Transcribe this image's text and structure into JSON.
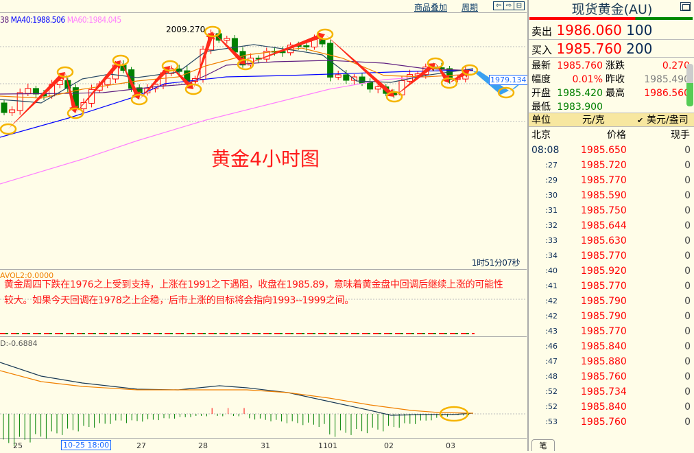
{
  "toolbar": {
    "overlay": "商品叠加",
    "period": "周期",
    "nav_left": "⇦",
    "nav_right": "⇨",
    "nav_split": "⊟"
  },
  "ma_legend": {
    "ma_prev": "38",
    "ma40": "MA40:1988.506",
    "ma60": "MA60:1984.045"
  },
  "chart": {
    "high_label": "2009.270",
    "title": "黄金4小时图",
    "projection_label": "1979.134",
    "countdown": "1时51分07秒",
    "colors": {
      "up": "#ff0000",
      "down": "#008000",
      "ma40": "#0000ff",
      "ma60": "#ff80ff",
      "arrow": "#ff2a1a",
      "circle": "#f5b400",
      "projection": "#3aa0f0"
    }
  },
  "volume": {
    "label": "AVOL2:0.0000"
  },
  "analysis": {
    "text": "黄金周四下跌在1976之上受到支持，上涨在1991之下遇阻，收盘在1985.89，意味着黄金盘中回调后继续上涨的可能性较大。如果今天回调在1978之上企稳，后市上涨的目标将会指向1993--1999之间。"
  },
  "macd": {
    "label": "D:-0.6884"
  },
  "xaxis": {
    "labels": [
      "25",
      "27",
      "28",
      "31",
      "1101",
      "02",
      "03"
    ],
    "cursor": "10-25 18:00"
  },
  "panel": {
    "title": "现货黄金(AU)",
    "sell": {
      "label": "卖出",
      "price": "1986.060",
      "vol": "100"
    },
    "buy": {
      "label": "买入",
      "price": "1985.760",
      "vol": "200"
    },
    "stats": [
      {
        "label": "最新",
        "value": "1985.760",
        "color": "#ff0000"
      },
      {
        "label": "涨跌",
        "value": "0.270",
        "color": "#ff0000"
      },
      {
        "label": "幅度",
        "value": "0.01%",
        "color": "#ff0000"
      },
      {
        "label": "昨收",
        "value": "1985.490",
        "color": "#808080"
      },
      {
        "label": "开盘",
        "value": "1985.420",
        "color": "#008000"
      },
      {
        "label": "最高",
        "value": "1986.560",
        "color": "#ff0000"
      },
      {
        "label": "最低",
        "value": "1983.900",
        "color": "#008000"
      }
    ],
    "unit": {
      "label": "单位",
      "opt1": "元/克",
      "opt2": "美元/盎司",
      "check": "✔"
    },
    "ticks_header": {
      "place": "北京",
      "price": "价格",
      "vol": "现手"
    },
    "ticks": [
      {
        "t": "08:08",
        "p": "1985.650",
        "v": "0"
      },
      {
        "t": ":27",
        "p": "1985.720",
        "v": "0"
      },
      {
        "t": ":29",
        "p": "1985.770",
        "v": "0"
      },
      {
        "t": ":30",
        "p": "1985.590",
        "v": "0"
      },
      {
        "t": ":31",
        "p": "1985.750",
        "v": "0"
      },
      {
        "t": ":32",
        "p": "1985.644",
        "v": "0"
      },
      {
        "t": ":33",
        "p": "1985.630",
        "v": "0"
      },
      {
        "t": ":34",
        "p": "1985.770",
        "v": "0"
      },
      {
        "t": ":40",
        "p": "1985.920",
        "v": "0"
      },
      {
        "t": ":41",
        "p": "1985.770",
        "v": "0"
      },
      {
        "t": ":42",
        "p": "1985.790",
        "v": "0"
      },
      {
        "t": ":42",
        "p": "1985.790",
        "v": "0"
      },
      {
        "t": ":43",
        "p": "1985.770",
        "v": "0"
      },
      {
        "t": ":46",
        "p": "1985.840",
        "v": "0"
      },
      {
        "t": ":47",
        "p": "1985.880",
        "v": "0"
      },
      {
        "t": ":48",
        "p": "1985.760",
        "v": "0"
      },
      {
        "t": ":52",
        "p": "1985.734",
        "v": "0"
      },
      {
        "t": ":52",
        "p": "1985.840",
        "v": "0"
      },
      {
        "t": ":53",
        "p": "1985.760",
        "v": "0"
      }
    ],
    "tab": "笔"
  }
}
